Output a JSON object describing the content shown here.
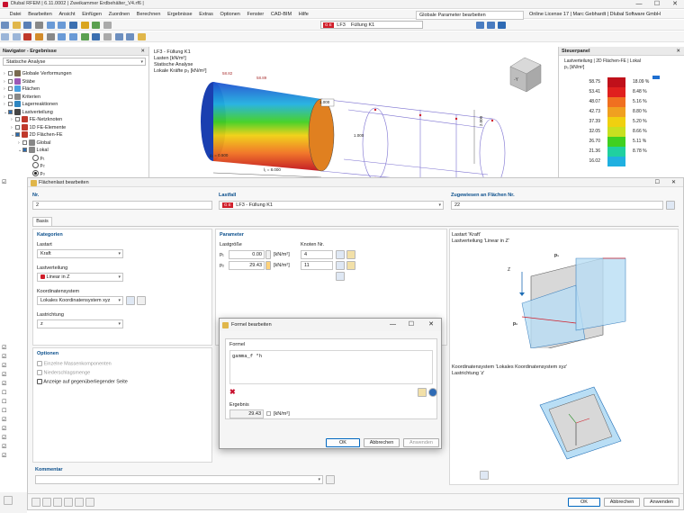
{
  "window": {
    "title": "Dlubal RFEM | 6.11.0002 | Zweikammer Erdbehälter_V4.rf6 |",
    "minimize": "—",
    "maximize": "☐",
    "close": "✕"
  },
  "menu": {
    "items": [
      "Datei",
      "Bearbeiten",
      "Ansicht",
      "Einfügen",
      "Zuordnen",
      "Berechnen",
      "Ergebnisse",
      "Extras",
      "Optionen",
      "Fenster",
      "CAD-BIM",
      "Hilfe"
    ],
    "right_combo": "Globale Parameter bearbeiten",
    "license": "Online License 17 | Marc Gebhardt | Dlubal Software GmbH"
  },
  "toolbar": {
    "lc_badge": "G E",
    "lc_code": "LF3",
    "lc_name": "Füllung K1"
  },
  "navigator": {
    "title": "Navigator - Ergebnisse",
    "combo": "Statische Analyse",
    "tree": [
      {
        "label": "Globale Verformungen",
        "color": "#7a6a4f"
      },
      {
        "label": "Stäbe",
        "color": "#9b59b6"
      },
      {
        "label": "Flächen",
        "color": "#4aa0e0"
      },
      {
        "label": "Kriterien",
        "color": "#888888"
      },
      {
        "label": "Lagerreaktionen",
        "color": "#2e86c1"
      },
      {
        "label": "Lastverteilung",
        "color": "#444444"
      },
      {
        "label": "FE-Netzknoten",
        "color": "#c0392b"
      },
      {
        "label": "1D FE-Elemente",
        "color": "#c0392b"
      },
      {
        "label": "2D Flächen-FE",
        "color": "#c0392b"
      },
      {
        "label": "Global",
        "color": "#888888"
      },
      {
        "label": "Lokal",
        "color": "#888888"
      },
      {
        "label": "p₁",
        "color": "#ffffff"
      },
      {
        "label": "p₂",
        "color": "#ffffff"
      },
      {
        "label": "p₃",
        "color": "#ffffff"
      }
    ]
  },
  "viewport": {
    "lines": [
      "LF3 - Füllung K1",
      "Lasten [kN/m²]",
      "Statische Analyse",
      "Lokale Kräfte p₃ [kN/m²]"
    ],
    "annotations": [
      "58.82",
      "58.89",
      "1.000",
      "1.000",
      "2.000"
    ],
    "dim1": "g₁ = 0.500",
    "dim2": "l₁ = 8.000",
    "cube_label": "-Y"
  },
  "control_panel": {
    "title": "Steuerpanel",
    "subtitle": "Lastverteilung | 2D Flächen-FE | Lokal",
    "unit": "p₃ [kN/m²]",
    "rows": [
      {
        "value": "58.75",
        "color": "#c0101a",
        "pct": "18.09 %"
      },
      {
        "value": "53.41",
        "color": "#e0201e",
        "pct": "8.48 %"
      },
      {
        "value": "48.07",
        "color": "#f07020",
        "pct": "5.16 %"
      },
      {
        "value": "42.73",
        "color": "#f0a020",
        "pct": "8.80 %"
      },
      {
        "value": "37.39",
        "color": "#f0d010",
        "pct": "5.20 %"
      },
      {
        "value": "32.05",
        "color": "#c8e020",
        "pct": "8.66 %"
      },
      {
        "value": "26.70",
        "color": "#40d020",
        "pct": "5.11 %"
      },
      {
        "value": "21.36",
        "color": "#20d0a0",
        "pct": "8.78 %"
      },
      {
        "value": "16.02",
        "color": "#20b0e0",
        "pct": ""
      }
    ]
  },
  "flaechenlast": {
    "title": "Flächenlast bearbeiten",
    "no_label": "Nr.",
    "no_value": "2",
    "lastfall_label": "Lastfall",
    "lastfall_badge": "G E",
    "lastfall_value": "LF3 - Füllung K1",
    "assigned_label": "Zugewiesen an Flächen Nr.",
    "assigned_value": "22",
    "tab_basis": "Basis",
    "kategorien": "Kategorien",
    "lastart_label": "Lastart",
    "lastart_value": "Kraft",
    "lastverteilung_label": "Lastverteilung",
    "lastverteilung_value": "Linear in Z",
    "koordsys_label": "Koordinatensystem",
    "koordsys_value": "Lokales Koordinatensystem xyz",
    "lastrichtung_label": "Lastrichtung",
    "lastrichtung_value": "z",
    "parameter": "Parameter",
    "lastgroesse": "Lastgröße",
    "knoten_nr": "Knoten Nr.",
    "p1_label": "p₁",
    "p1_value": "0.00",
    "p2_label": "p₂",
    "p2_value": "29.43",
    "unit": "[kN/m²]",
    "knoten1": "4",
    "knoten2": "11",
    "optionen": "Optionen",
    "opt1": "Einzelne Massenkomponenten",
    "opt2": "Niederschlagsmenge",
    "opt3": "Anzeige auf gegenüberliegender Seite",
    "kommentar": "Kommentar",
    "preview1_line1": "Lastart 'Kraft'",
    "preview1_line2": "Lastverteilung 'Linear in Z'",
    "preview2_line1": "Koordinatensystem 'Lokales Koordinatensystem xyz'",
    "preview2_line2": "Lastrichtung 'z'",
    "ok": "OK",
    "cancel": "Abbrechen",
    "apply": "Anwenden"
  },
  "formula": {
    "title": "Formel bearbeiten",
    "formel_label": "Formel",
    "expression": "gamma_f *h",
    "ergebnis_label": "Ergebnis",
    "result": "29.43",
    "unit": "[kN/m²]",
    "ok": "OK",
    "cancel": "Abbrechen",
    "apply": "Anwenden"
  }
}
